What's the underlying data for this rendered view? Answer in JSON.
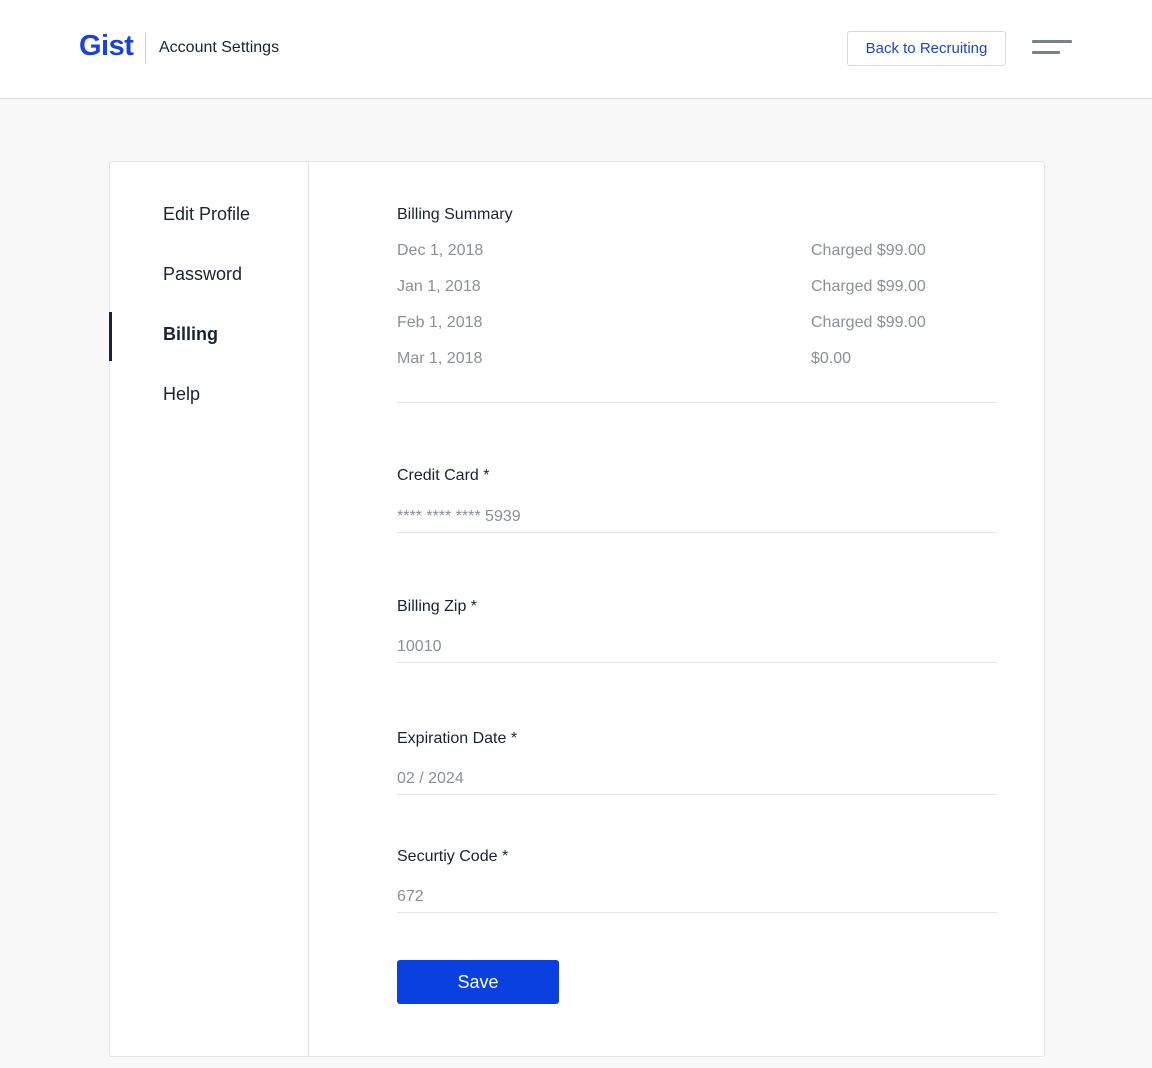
{
  "header": {
    "logo": "Gist",
    "title": "Account Settings",
    "back_button": "Back to Recruiting",
    "menu_icon": "hamburger-menu-icon"
  },
  "sidebar": {
    "items": [
      {
        "label": "Edit Profile",
        "active": false
      },
      {
        "label": "Password",
        "active": false
      },
      {
        "label": "Billing",
        "active": true
      },
      {
        "label": "Help",
        "active": false
      }
    ]
  },
  "billing_summary": {
    "title": "Billing Summary",
    "rows": [
      {
        "date": "Dec 1, 2018",
        "amount": "Charged $99.00"
      },
      {
        "date": "Jan 1, 2018",
        "amount": "Charged $99.00"
      },
      {
        "date": "Feb 1, 2018",
        "amount": "Charged $99.00"
      },
      {
        "date": "Mar 1, 2018",
        "amount": "$0.00"
      }
    ]
  },
  "form": {
    "credit_card": {
      "label": "Credit Card *",
      "value": "**** **** **** 5939"
    },
    "billing_zip": {
      "label": "Billing Zip *",
      "value": "10010"
    },
    "expiration_date": {
      "label": "Expiration Date *",
      "value": "02 / 2024"
    },
    "security_code": {
      "label": "Securtiy Code *",
      "value": "672"
    },
    "save_label": "Save"
  },
  "colors": {
    "brand": "#1a44d8",
    "primary_button": "#0a3fe0",
    "text": "#1a2233",
    "muted_text": "#8a8f98"
  }
}
